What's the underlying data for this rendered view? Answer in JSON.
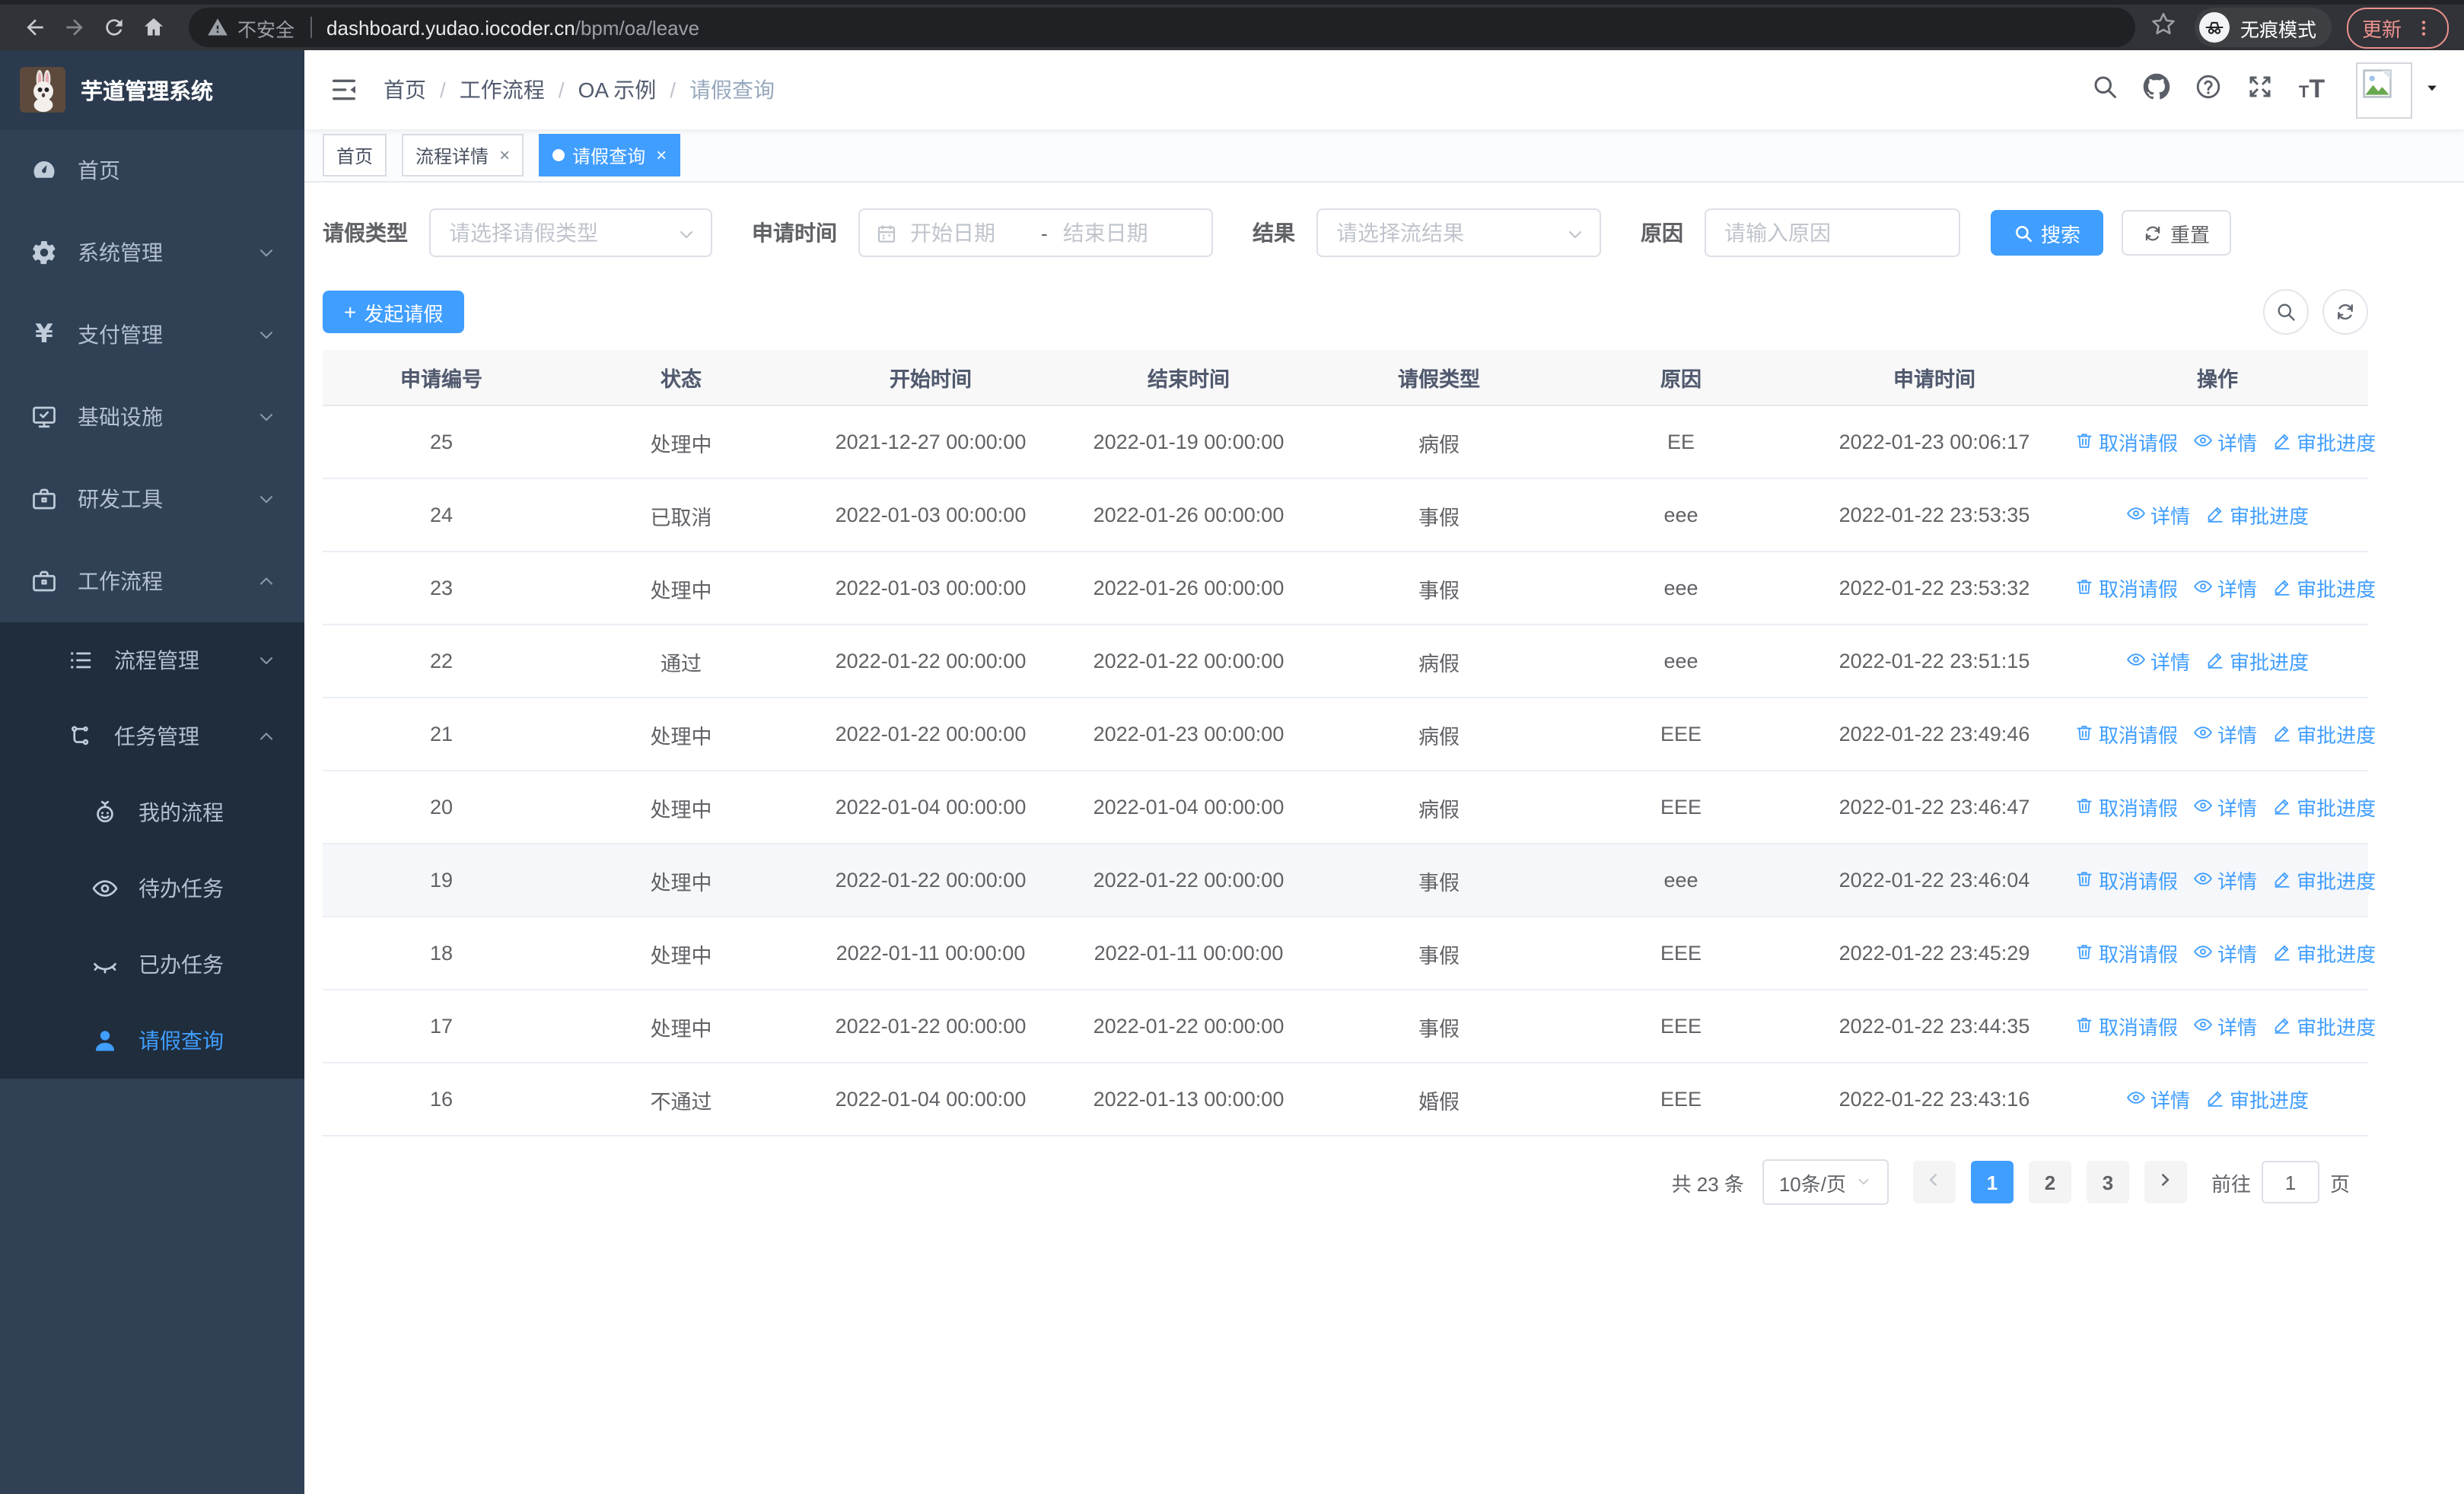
{
  "browser": {
    "security_label": "不安全",
    "url_host": "dashboard.yudao.iocoder.cn",
    "url_path": "/bpm/oa/leave",
    "incognito_label": "无痕模式",
    "update_label": "更新",
    "accent_color": "#ec928e"
  },
  "sidebar": {
    "title": "芋道管理系统",
    "colors": {
      "bg": "#304156",
      "submenu_bg": "#1f2d3d",
      "text": "#b4c0d1",
      "active": "#409eff"
    },
    "items": [
      {
        "name": "home",
        "icon": "dashboard",
        "label": "首页"
      },
      {
        "name": "system",
        "icon": "gear",
        "label": "系统管理",
        "chevron": "down"
      },
      {
        "name": "payment",
        "icon": "yen",
        "label": "支付管理",
        "chevron": "down"
      },
      {
        "name": "infrastructure",
        "icon": "monitor",
        "label": "基础设施",
        "chevron": "down"
      },
      {
        "name": "devtools",
        "icon": "briefcase",
        "label": "研发工具",
        "chevron": "down"
      },
      {
        "name": "workflow",
        "icon": "briefcase",
        "label": "工作流程",
        "chevron": "up",
        "children": [
          {
            "name": "process-mgmt",
            "icon": "list",
            "label": "流程管理",
            "chevron": "down"
          },
          {
            "name": "task-mgmt",
            "icon": "tree",
            "label": "任务管理",
            "chevron": "up",
            "children": [
              {
                "name": "my-process",
                "icon": "robot",
                "label": "我的流程"
              },
              {
                "name": "todo-tasks",
                "icon": "eye",
                "label": "待办任务"
              },
              {
                "name": "done-tasks",
                "icon": "eye-closed",
                "label": "已办任务"
              },
              {
                "name": "leave-query",
                "icon": "user",
                "label": "请假查询",
                "active": true
              }
            ]
          }
        ]
      }
    ]
  },
  "header": {
    "breadcrumb": [
      "首页",
      "工作流程",
      "OA 示例",
      "请假查询"
    ],
    "icons": [
      "search",
      "github",
      "question",
      "fullscreen",
      "fontsize"
    ]
  },
  "tabs": [
    {
      "name": "home",
      "label": "首页",
      "closable": false,
      "active": false
    },
    {
      "name": "process-detail",
      "label": "流程详情",
      "closable": true,
      "active": false
    },
    {
      "name": "leave-query",
      "label": "请假查询",
      "closable": true,
      "active": true
    }
  ],
  "filters": {
    "leave_type": {
      "label": "请假类型",
      "placeholder": "请选择请假类型"
    },
    "apply_time": {
      "label": "申请时间",
      "start_placeholder": "开始日期",
      "separator": "-",
      "end_placeholder": "结束日期"
    },
    "result": {
      "label": "结果",
      "placeholder": "请选择流结果"
    },
    "reason": {
      "label": "原因",
      "placeholder": "请输入原因"
    },
    "search_label": "搜索",
    "reset_label": "重置"
  },
  "toolbar": {
    "create_label": "发起请假",
    "plus": "+"
  },
  "table": {
    "columns": [
      "申请编号",
      "状态",
      "开始时间",
      "结束时间",
      "请假类型",
      "原因",
      "申请时间",
      "操作"
    ],
    "action_labels": {
      "cancel": "取消请假",
      "detail": "详情",
      "progress": "审批进度"
    },
    "rows": [
      {
        "id": "25",
        "status": "处理中",
        "start": "2021-12-27 00:00:00",
        "end": "2022-01-19 00:00:00",
        "type": "病假",
        "reason": "EE",
        "apply_time": "2022-01-23 00:06:17",
        "actions": [
          "cancel",
          "detail",
          "progress"
        ]
      },
      {
        "id": "24",
        "status": "已取消",
        "start": "2022-01-03 00:00:00",
        "end": "2022-01-26 00:00:00",
        "type": "事假",
        "reason": "eee",
        "apply_time": "2022-01-22 23:53:35",
        "actions": [
          "detail",
          "progress"
        ]
      },
      {
        "id": "23",
        "status": "处理中",
        "start": "2022-01-03 00:00:00",
        "end": "2022-01-26 00:00:00",
        "type": "事假",
        "reason": "eee",
        "apply_time": "2022-01-22 23:53:32",
        "actions": [
          "cancel",
          "detail",
          "progress"
        ]
      },
      {
        "id": "22",
        "status": "通过",
        "start": "2022-01-22 00:00:00",
        "end": "2022-01-22 00:00:00",
        "type": "病假",
        "reason": "eee",
        "apply_time": "2022-01-22 23:51:15",
        "actions": [
          "detail",
          "progress"
        ]
      },
      {
        "id": "21",
        "status": "处理中",
        "start": "2022-01-22 00:00:00",
        "end": "2022-01-23 00:00:00",
        "type": "病假",
        "reason": "EEE",
        "apply_time": "2022-01-22 23:49:46",
        "actions": [
          "cancel",
          "detail",
          "progress"
        ]
      },
      {
        "id": "20",
        "status": "处理中",
        "start": "2022-01-04 00:00:00",
        "end": "2022-01-04 00:00:00",
        "type": "病假",
        "reason": "EEE",
        "apply_time": "2022-01-22 23:46:47",
        "actions": [
          "cancel",
          "detail",
          "progress"
        ]
      },
      {
        "id": "19",
        "status": "处理中",
        "start": "2022-01-22 00:00:00",
        "end": "2022-01-22 00:00:00",
        "type": "事假",
        "reason": "eee",
        "apply_time": "2022-01-22 23:46:04",
        "actions": [
          "cancel",
          "detail",
          "progress"
        ],
        "highlighted": true
      },
      {
        "id": "18",
        "status": "处理中",
        "start": "2022-01-11 00:00:00",
        "end": "2022-01-11 00:00:00",
        "type": "事假",
        "reason": "EEE",
        "apply_time": "2022-01-22 23:45:29",
        "actions": [
          "cancel",
          "detail",
          "progress"
        ]
      },
      {
        "id": "17",
        "status": "处理中",
        "start": "2022-01-22 00:00:00",
        "end": "2022-01-22 00:00:00",
        "type": "事假",
        "reason": "EEE",
        "apply_time": "2022-01-22 23:44:35",
        "actions": [
          "cancel",
          "detail",
          "progress"
        ]
      },
      {
        "id": "16",
        "status": "不通过",
        "start": "2022-01-04 00:00:00",
        "end": "2022-01-13 00:00:00",
        "type": "婚假",
        "reason": "EEE",
        "apply_time": "2022-01-22 23:43:16",
        "actions": [
          "detail",
          "progress"
        ]
      }
    ]
  },
  "pagination": {
    "total_text": "共 23 条",
    "page_size_text": "10条/页",
    "pages": [
      "1",
      "2",
      "3"
    ],
    "current_page": "1",
    "goto_label": "前往",
    "goto_value": "1",
    "page_unit": "页"
  },
  "colors": {
    "primary": "#409eff",
    "table_header_bg": "#f8f8f9",
    "row_hover": "#f5f7fa"
  }
}
